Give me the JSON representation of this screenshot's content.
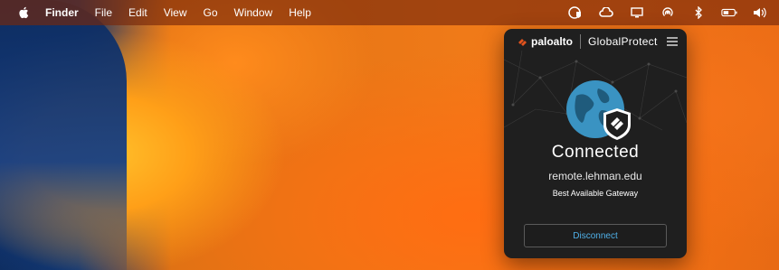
{
  "menubar": {
    "app_name": "Finder",
    "menus": [
      "File",
      "Edit",
      "View",
      "Go",
      "Window",
      "Help"
    ],
    "status_icons": [
      "globalprotect-icon",
      "creative-cloud-icon",
      "display-icon",
      "airplay-icon",
      "bluetooth-icon",
      "battery-icon",
      "volume-icon"
    ]
  },
  "globalprotect": {
    "brand": "paloalto",
    "product": "GlobalProtect",
    "status": "Connected",
    "portal": "remote.lehman.edu",
    "gateway": "Best Available Gateway",
    "disconnect_label": "Disconnect",
    "accent_color": "#4fb0e8"
  }
}
